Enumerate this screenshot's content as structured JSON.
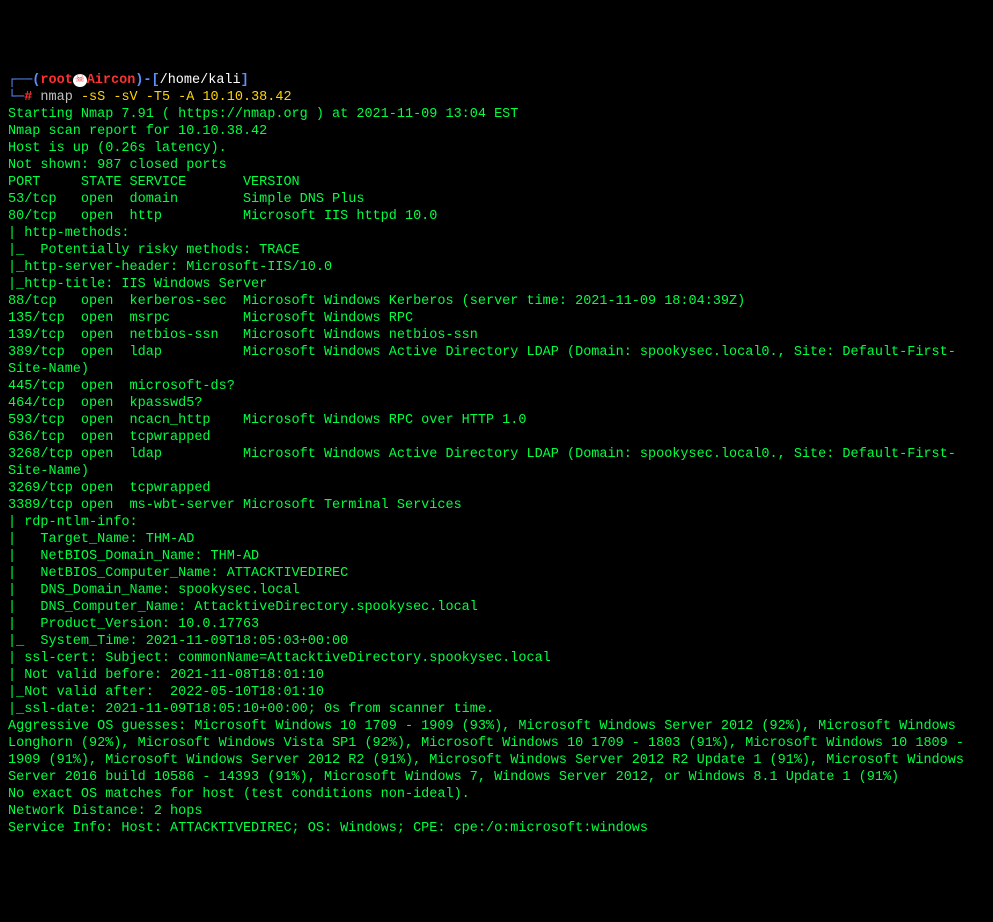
{
  "prompt_head": {
    "dash1": "┌──(",
    "user": "root",
    "skull": "☠",
    "host": "Aircon",
    "paren_close": ")-[",
    "cwd": "/home/kali",
    "bracket_close": "]",
    "dash2": "└─",
    "hash": "#",
    "cmd": "nmap",
    "args": "-sS -sV -T5 -A 10.10.38.42"
  },
  "out": {
    "l1": "Starting Nmap 7.91 ( https://nmap.org ) at 2021-11-09 13:04 EST",
    "l2": "Nmap scan report for 10.10.38.42",
    "l3": "Host is up (0.26s latency).",
    "l4": "Not shown: 987 closed ports",
    "l5": "PORT     STATE SERVICE       VERSION",
    "l6": "53/tcp   open  domain        Simple DNS Plus",
    "l7": "80/tcp   open  http          Microsoft IIS httpd 10.0",
    "l8": "| http-methods: ",
    "l9": "|_  Potentially risky methods: TRACE",
    "l10": "|_http-server-header: Microsoft-IIS/10.0",
    "l11": "|_http-title: IIS Windows Server",
    "l12": "88/tcp   open  kerberos-sec  Microsoft Windows Kerberos (server time: 2021-11-09 18:04:39Z)",
    "l13": "135/tcp  open  msrpc         Microsoft Windows RPC",
    "l14": "139/tcp  open  netbios-ssn   Microsoft Windows netbios-ssn",
    "l15": "389/tcp  open  ldap          Microsoft Windows Active Directory LDAP (Domain: spookysec.local0., Site: Default-First-Site-Name)",
    "l16": "445/tcp  open  microsoft-ds?",
    "l17": "464/tcp  open  kpasswd5?",
    "l18": "593/tcp  open  ncacn_http    Microsoft Windows RPC over HTTP 1.0",
    "l19": "636/tcp  open  tcpwrapped",
    "l20": "3268/tcp open  ldap          Microsoft Windows Active Directory LDAP (Domain: spookysec.local0., Site: Default-First-Site-Name)",
    "l21": "3269/tcp open  tcpwrapped",
    "l22": "3389/tcp open  ms-wbt-server Microsoft Terminal Services",
    "l23": "| rdp-ntlm-info: ",
    "l24": "|   Target_Name: THM-AD",
    "l25": "|   NetBIOS_Domain_Name: THM-AD",
    "l26": "|   NetBIOS_Computer_Name: ATTACKTIVEDIREC",
    "l27": "|   DNS_Domain_Name: spookysec.local",
    "l28": "|   DNS_Computer_Name: AttacktiveDirectory.spookysec.local",
    "l29": "|   Product_Version: 10.0.17763",
    "l30": "|_  System_Time: 2021-11-09T18:05:03+00:00",
    "l31": "| ssl-cert: Subject: commonName=AttacktiveDirectory.spookysec.local",
    "l32": "| Not valid before: 2021-11-08T18:01:10",
    "l33": "|_Not valid after:  2022-05-10T18:01:10",
    "l34": "|_ssl-date: 2021-11-09T18:05:10+00:00; 0s from scanner time.",
    "l35": "Aggressive OS guesses: Microsoft Windows 10 1709 - 1909 (93%), Microsoft Windows Server 2012 (92%), Microsoft Windows Longhorn (92%), Microsoft Windows Vista SP1 (92%), Microsoft Windows 10 1709 - 1803 (91%), Microsoft Windows 10 1809 - 1909 (91%), Microsoft Windows Server 2012 R2 (91%), Microsoft Windows Server 2012 R2 Update 1 (91%), Microsoft Windows Server 2016 build 10586 - 14393 (91%), Microsoft Windows 7, Windows Server 2012, or Windows 8.1 Update 1 (91%)",
    "l36": "No exact OS matches for host (test conditions non-ideal).",
    "l37": "Network Distance: 2 hops",
    "l38": "Service Info: Host: ATTACKTIVEDIREC; OS: Windows; CPE: cpe:/o:microsoft:windows"
  }
}
